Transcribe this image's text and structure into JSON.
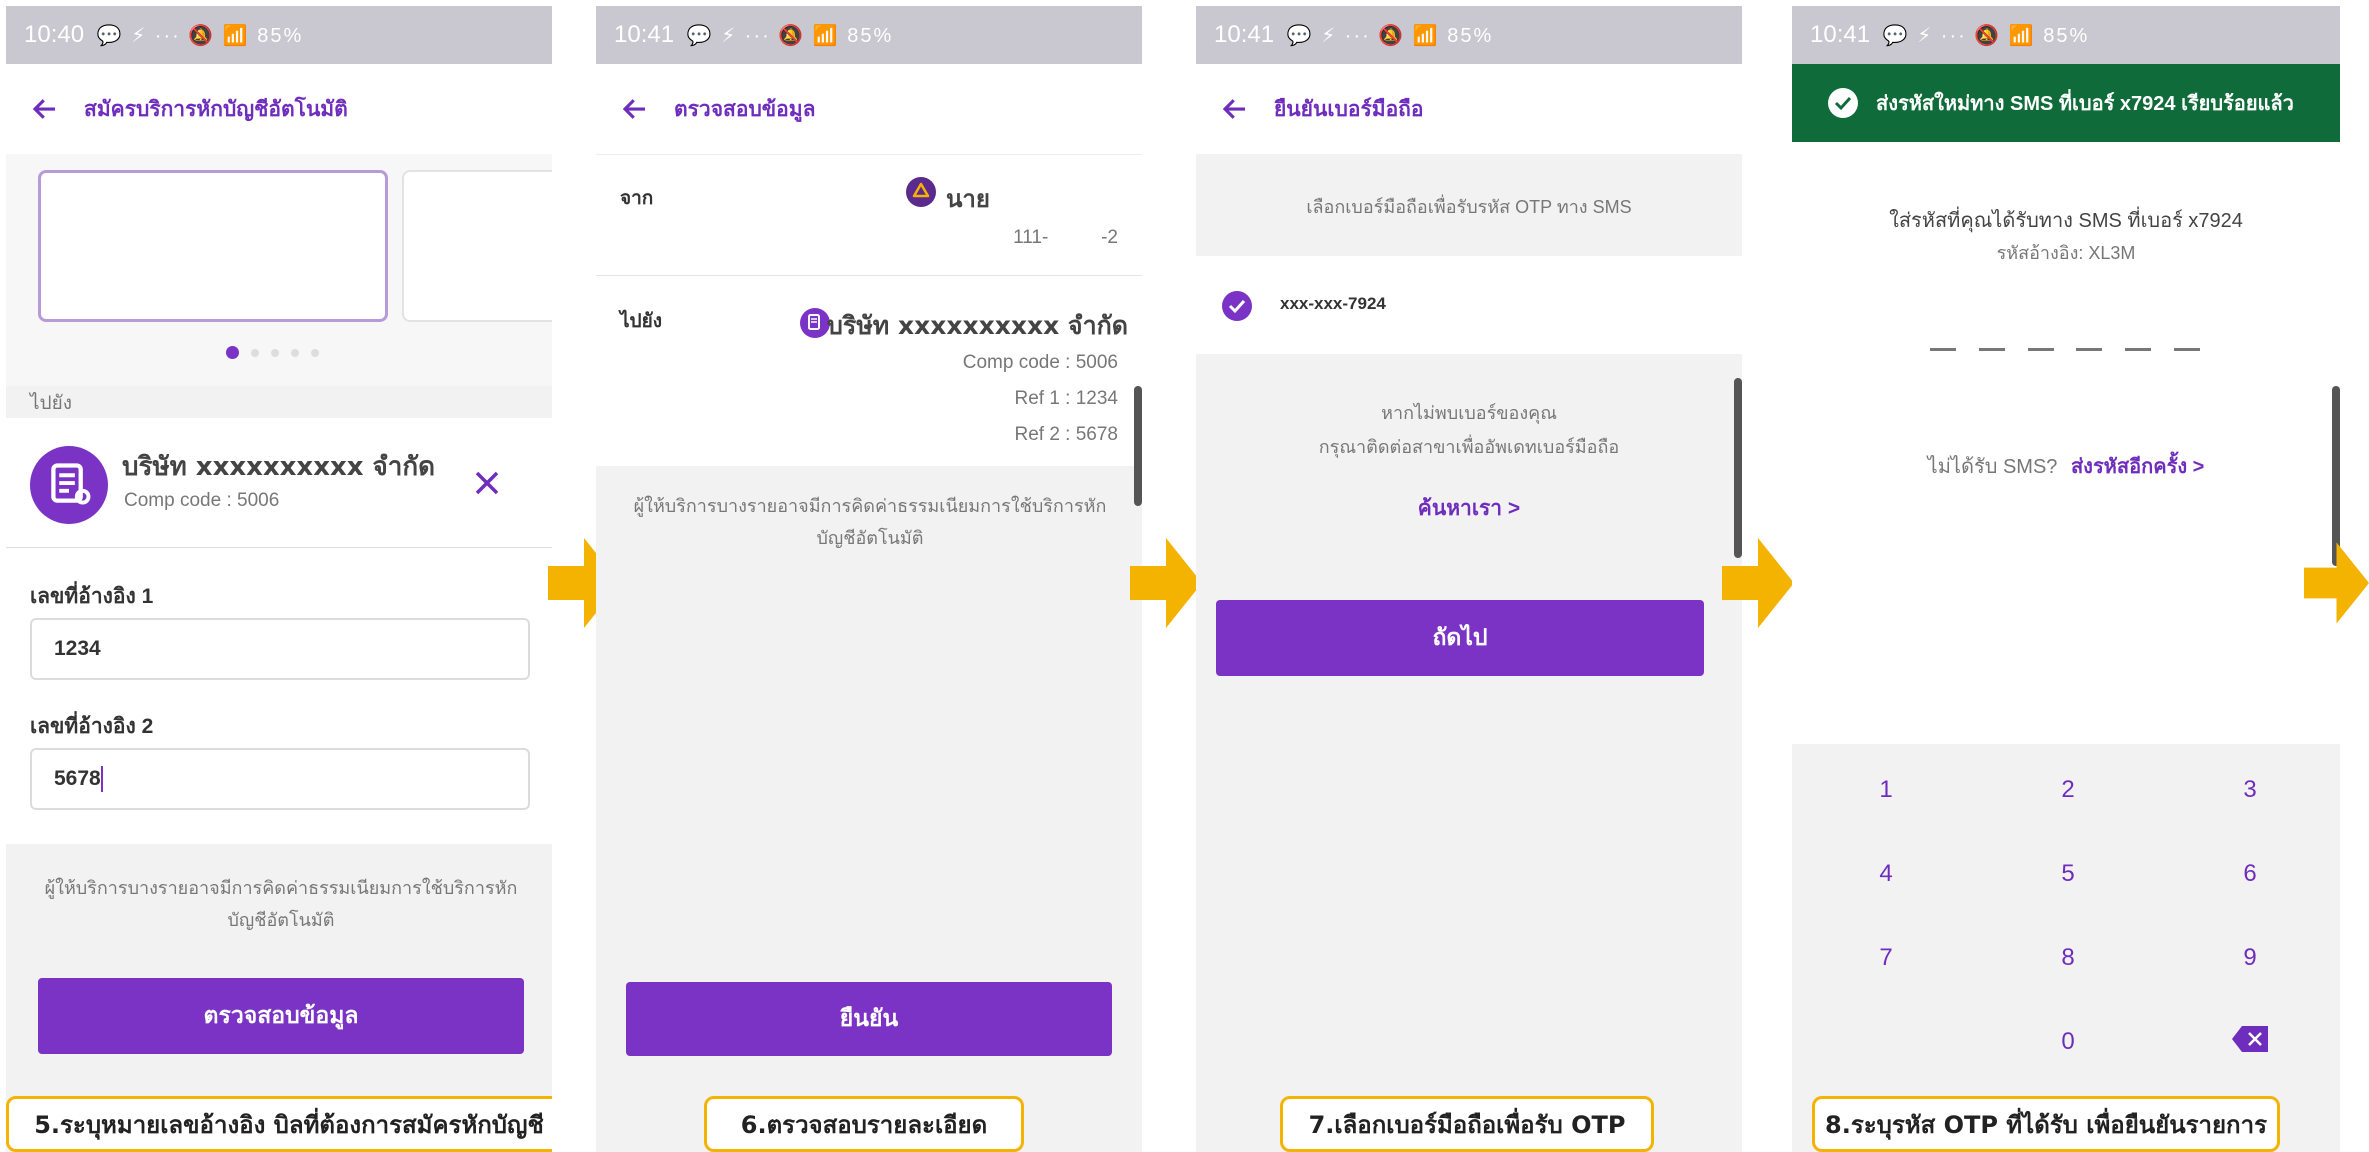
{
  "screens": {
    "s5": {
      "status_time": "10:40",
      "status_icons": "💬 ⚡ ··· 🔕 📶 85%",
      "title": "สมัครบริการหักบัญชีอัตโนมัติ",
      "to_label": "ไปยัง",
      "company_name": "บริษัท xxxxxxxxxx จำกัด",
      "comp_code": "Comp code : 5006",
      "ref1_label": "เลขที่อ้างอิง 1",
      "ref1_value": "1234",
      "ref2_label": "เลขที่อ้างอิง 2",
      "ref2_value": "5678",
      "fee_note": "ผู้ให้บริการบางรายอาจมีการคิดค่าธรรมเนียมการใช้บริการหักบัญชีอัตโนมัติ",
      "button": "ตรวจสอบข้อมูล",
      "caption": "5.ระบุหมายเลขอ้างอิง บิลที่ต้องการสมัครหักบัญชี"
    },
    "s6": {
      "status_time": "10:41",
      "status_icons": "💬 ⚡ ··· 🔕 📶 85%",
      "title": "ตรวจสอบข้อมูล",
      "from_label": "จาก",
      "from_name": "นาย",
      "from_account": "111-          -2",
      "to_label": "ไปยัง",
      "company_name": "บริษัท xxxxxxxxxx จำกัด",
      "comp_code": "Comp code : 5006",
      "ref1": "Ref 1 : 1234",
      "ref2": "Ref 2 : 5678",
      "fee_note": "ผู้ให้บริการบางรายอาจมีการคิดค่าธรรมเนียมการใช้บริการหักบัญชีอัตโนมัติ",
      "button": "ยืนยัน",
      "caption": "6.ตรวจสอบรายละเอียด"
    },
    "s7": {
      "status_time": "10:41",
      "status_icons": "💬 ⚡ ··· 🔕 📶 85%",
      "title": "ยืนยันเบอร์มือถือ",
      "instruction": "เลือกเบอร์มือถือเพื่อรับรหัส OTP ทาง SMS",
      "phone_number": "xxx-xxx-7924",
      "not_found_line1": "หากไม่พบเบอร์ของคุณ",
      "not_found_line2": "กรุณาติดต่อสาขาเพื่ออัพเดทเบอร์มือถือ",
      "contact_link": "ค้นหาเรา >",
      "button": "ถัดไป",
      "caption": "7.เลือกเบอร์มือถือเพื่อรับ OTP"
    },
    "s8": {
      "status_time": "10:41",
      "status_icons": "💬 ⚡ ··· 🔕 📶 85%",
      "toast": "ส่งรหัสใหม่ทาง SMS ที่เบอร์ x7924 เรียบร้อยแล้ว",
      "otp_instruction": "ใส่รหัสที่คุณได้รับทาง SMS ที่เบอร์ x7924",
      "ref_code": "รหัสอ้างอิง: XL3M",
      "not_received": "ไม่ได้รับ SMS?",
      "resend_link": "ส่งรหัสอีกครั้ง >",
      "keys": [
        "1",
        "2",
        "3",
        "4",
        "5",
        "6",
        "7",
        "8",
        "9",
        "0"
      ],
      "caption": "8.ระบุรหัส OTP ที่ได้รับ เพื่อยืนยันรายการ"
    }
  },
  "colors": {
    "primary": "#7a33c4",
    "accent_text": "#6f2dbd",
    "toast_bg": "#0f6b39",
    "arrow": "#f5b301"
  }
}
